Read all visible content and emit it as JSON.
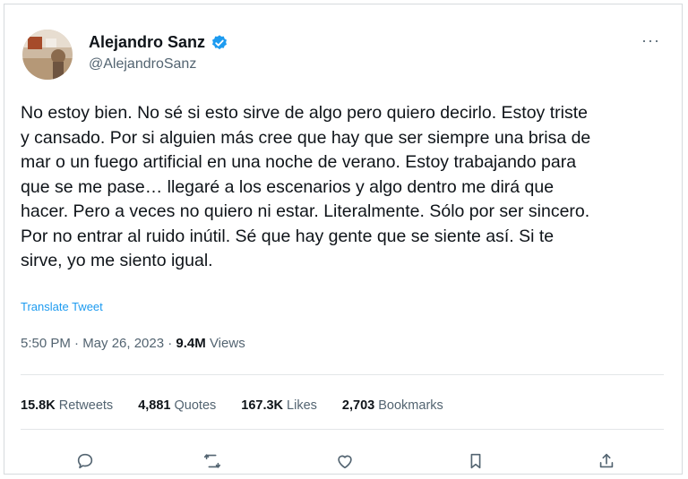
{
  "author": {
    "name": "Alejandro Sanz",
    "handle": "@AlejandroSanz",
    "verified_color": "#1d9bf0"
  },
  "more_label": "···",
  "tweet": {
    "text": "No estoy bien. No sé si esto sirve de algo pero quiero decirlo. Estoy triste\ny cansado. Por si alguien más cree que hay que ser siempre una brisa de\nmar o un fuego artificial en una noche de verano. Estoy trabajando para\nque se me pase… llegaré a los escenarios y algo dentro me dirá que\nhacer. Pero a veces no quiero ni estar. Literalmente. Sólo por ser sincero.\nPor no entrar al ruido inútil. Sé que hay gente que se siente así. Si te\nsirve, yo me siento igual.",
    "translate_label": "Translate Tweet",
    "time": "5:50 PM · May 26, 2023 · ",
    "views_count": "9.4M",
    "views_label": " Views"
  },
  "stats": {
    "retweets_count": "15.8K",
    "retweets_label": " Retweets",
    "quotes_count": "4,881",
    "quotes_label": " Quotes",
    "likes_count": "167.3K",
    "likes_label": " Likes",
    "bookmarks_count": "2,703",
    "bookmarks_label": " Bookmarks"
  },
  "actions": [
    "reply-icon",
    "retweet-icon",
    "like-icon",
    "bookmark-icon",
    "share-icon"
  ]
}
